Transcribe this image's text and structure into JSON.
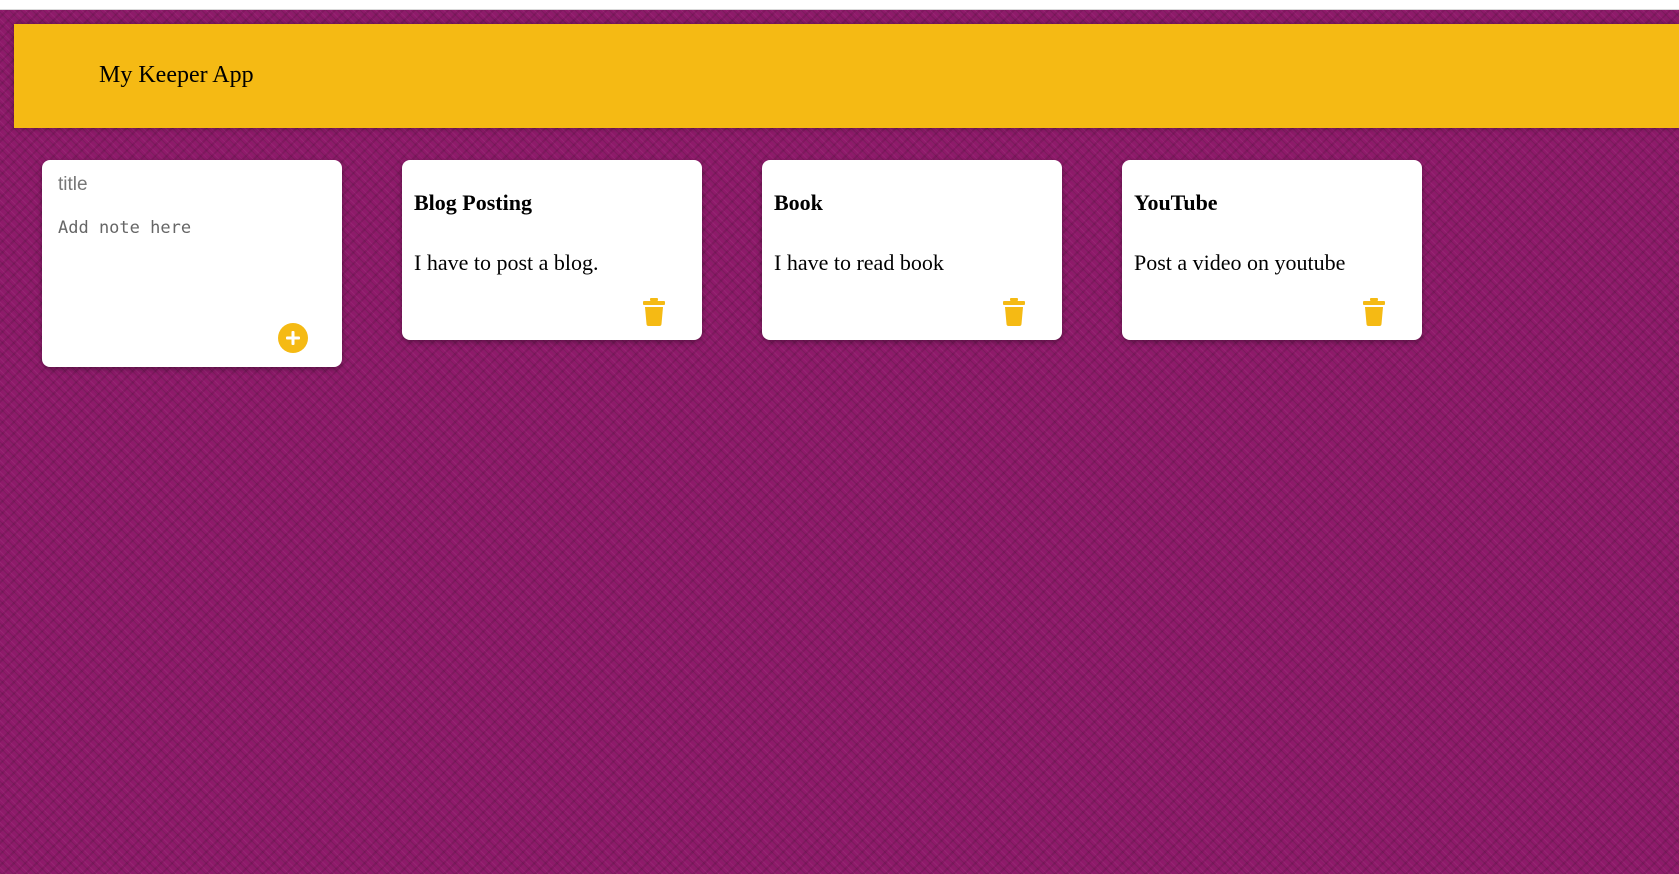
{
  "app": {
    "title": "My Keeper App"
  },
  "create_area": {
    "title_placeholder": "title",
    "content_placeholder": "Add note here",
    "add_icon": "plus-circle-icon"
  },
  "notes": [
    {
      "title": "Blog Posting",
      "content": "I have to post a blog.",
      "delete_icon": "trash-icon"
    },
    {
      "title": "Book",
      "content": "I have to read book",
      "delete_icon": "trash-icon"
    },
    {
      "title": "YouTube",
      "content": "Post a video on youtube",
      "delete_icon": "trash-icon"
    }
  ],
  "colors": {
    "header": "#f5ba14",
    "accent": "#f5ba14",
    "background": "#8e1a6a",
    "card": "#ffffff"
  }
}
